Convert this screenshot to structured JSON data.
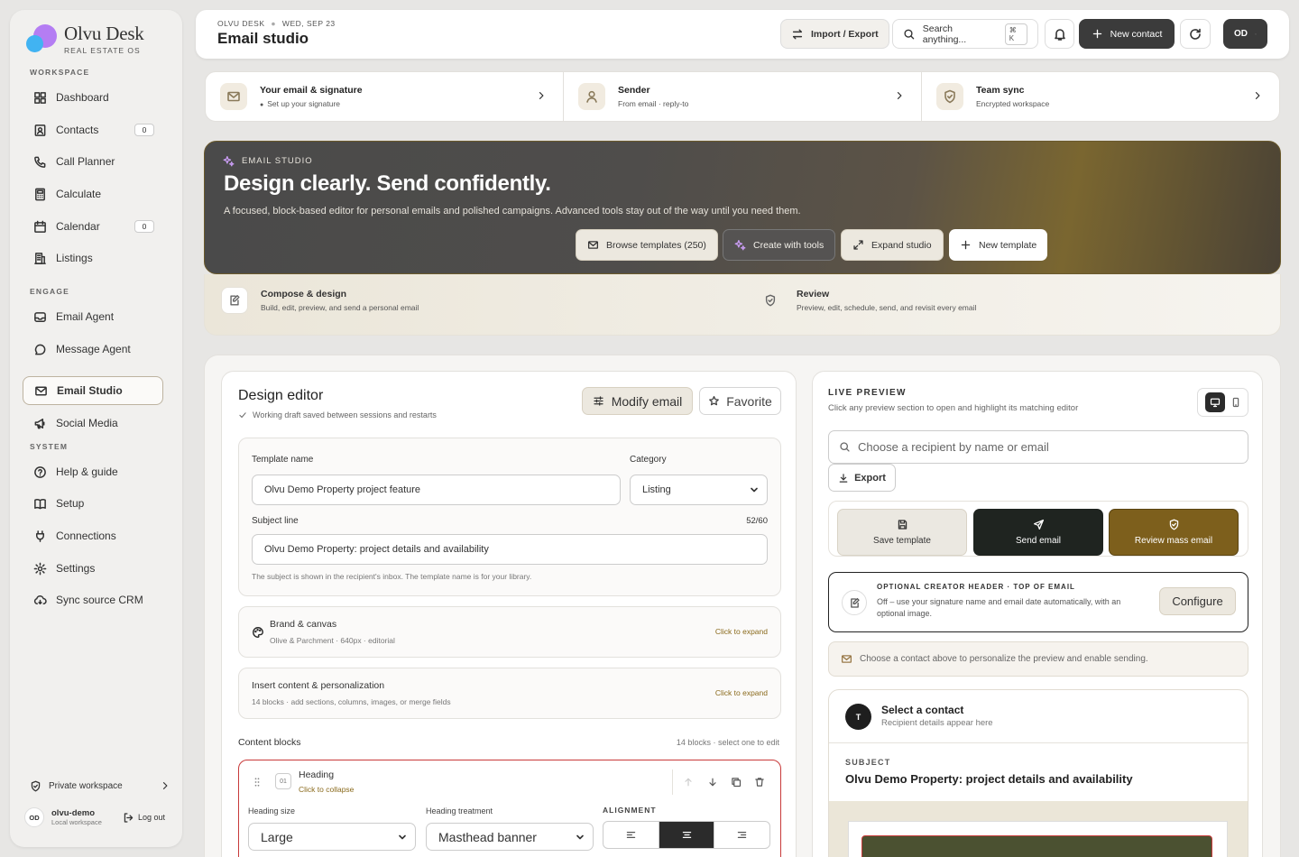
{
  "brand": {
    "name": "Olvu Desk",
    "tagline": "REAL ESTATE OS"
  },
  "sidebar": {
    "sections": {
      "workspace": "WORKSPACE",
      "engage": "ENGAGE",
      "system": "SYSTEM"
    },
    "items": [
      {
        "label": "Dashboard",
        "icon": "dashboard-icon"
      },
      {
        "label": "Contacts",
        "icon": "contacts-icon",
        "count": "0"
      },
      {
        "label": "Call Planner",
        "icon": "phone-icon"
      },
      {
        "label": "Calculate",
        "icon": "calculator-icon"
      },
      {
        "label": "Calendar",
        "icon": "calendar-icon",
        "count": "0"
      },
      {
        "label": "Listings",
        "icon": "building-icon"
      },
      {
        "label": "Email Agent",
        "icon": "inbox-icon"
      },
      {
        "label": "Message Agent",
        "icon": "chat-icon"
      },
      {
        "label": "Email Studio",
        "icon": "mail-icon",
        "active": true
      },
      {
        "label": "Social Media",
        "icon": "megaphone-icon"
      },
      {
        "label": "Help & guide",
        "icon": "help-icon"
      },
      {
        "label": "Setup",
        "icon": "book-icon"
      },
      {
        "label": "Connections",
        "icon": "plug-icon"
      },
      {
        "label": "Settings",
        "icon": "gear-icon"
      },
      {
        "label": "Sync source CRM",
        "icon": "cloud-sync-icon"
      }
    ],
    "private_workspace": "Private workspace",
    "user": {
      "initials": "OD",
      "name": "olvu-demo",
      "sub": "Local workspace",
      "logout": "Log out"
    }
  },
  "topbar": {
    "crumb_app": "OLVU DESK",
    "crumb_date": "WED, SEP 23",
    "title": "Email studio",
    "import_export": "Import / Export",
    "search_placeholder": "Search anything...",
    "search_kbd": "⌘ K",
    "new_contact": "New contact",
    "user_initials": "OD"
  },
  "setup_cards": [
    {
      "title": "Your email & signature",
      "sub": "Set up your signature",
      "icon": "mail-icon"
    },
    {
      "title": "Sender",
      "sub": "From email · reply-to",
      "icon": "user-icon"
    },
    {
      "title": "Team sync",
      "sub": "Encrypted workspace",
      "icon": "shield-icon"
    }
  ],
  "hero": {
    "eyebrow": "EMAIL STUDIO",
    "title": "Design clearly. Send confidently.",
    "description": "A focused, block-based editor for personal emails and polished campaigns. Advanced tools stay out of the way until you need them.",
    "buttons": {
      "browse": "Browse templates (250)",
      "create": "Create with tools",
      "expand": "Expand studio",
      "new_template": "New template"
    }
  },
  "steps": [
    {
      "title": "Compose & design",
      "sub": "Build, edit, preview, and send a personal email"
    },
    {
      "title": "Review",
      "sub": "Preview, edit, schedule, send, and revisit every email"
    }
  ],
  "editor": {
    "title": "Design editor",
    "saved": "Working draft saved between sessions and restarts",
    "modify": "Modify email",
    "favorite": "Favorite",
    "template_name_label": "Template name",
    "template_name": "Olvu Demo Property project feature",
    "category_label": "Category",
    "category": "Listing",
    "subject_label": "Subject line",
    "subject_count": "52/60",
    "subject": "Olvu Demo Property: project details and availability",
    "subject_hint": "The subject is shown in the recipient's inbox. The template name is for your library.",
    "brand_title": "Brand & canvas",
    "brand_sub": "Olive & Parchment · 640px · editorial",
    "insert_title": "Insert content & personalization",
    "insert_sub": "14 blocks · add sections, columns, images, or merge fields",
    "expand_label": "Click to expand",
    "blocks_title": "Content blocks",
    "blocks_meta": "14 blocks · select one to edit",
    "block": {
      "num": "01",
      "name": "Heading",
      "collapse": "Click to collapse",
      "size_label": "Heading size",
      "size": "Large",
      "treatment_label": "Heading treatment",
      "treatment": "Masthead banner",
      "alignment_label": "ALIGNMENT",
      "alignment": "center"
    }
  },
  "preview": {
    "title": "LIVE PREVIEW",
    "sub": "Click any preview section to open and highlight its matching editor",
    "recipient_placeholder": "Choose a recipient by name or email",
    "export": "Export",
    "save_template": "Save template",
    "send_email": "Send email",
    "review_mass": "Review mass email",
    "creator_title": "OPTIONAL CREATOR HEADER · TOP OF EMAIL",
    "creator_sub": "Off – use your signature name and email date automatically, with an optional image.",
    "configure": "Configure",
    "choose_notice": "Choose a contact above to personalize the preview and enable sending.",
    "contact_initial": "T",
    "contact_title": "Select a contact",
    "contact_sub": "Recipient details appear here",
    "subject_label": "SUBJECT",
    "subject": "Olvu Demo Property: project details and availability"
  }
}
